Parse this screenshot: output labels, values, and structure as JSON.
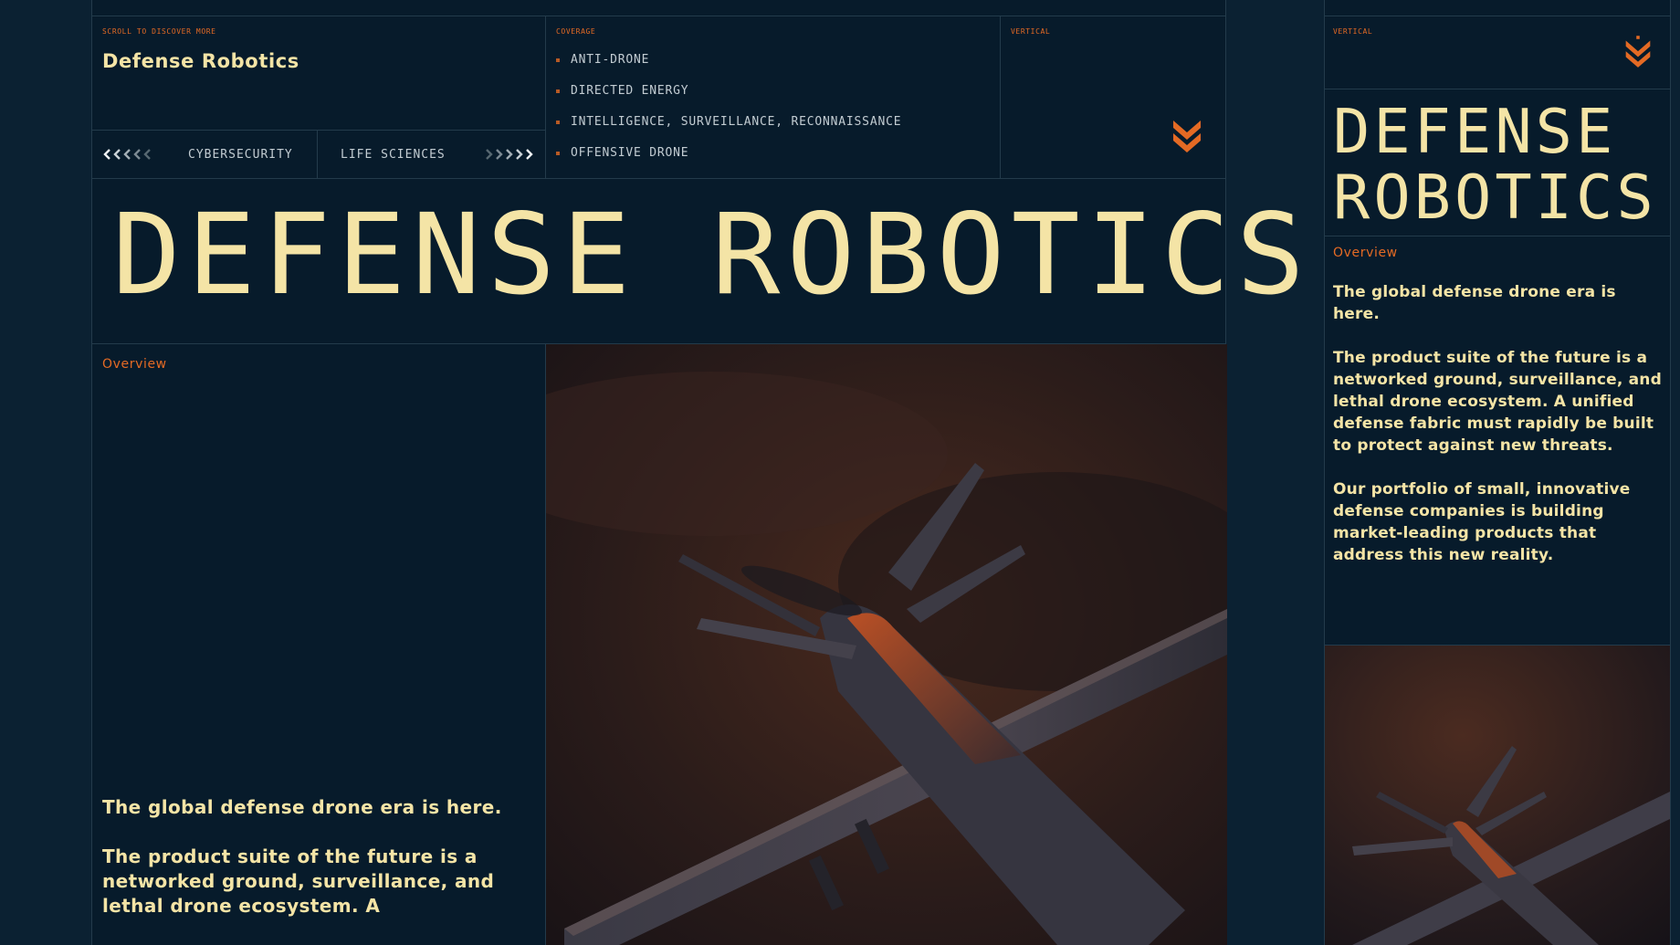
{
  "header": {
    "scroll_hint": "SCROLL TO DISCOVER MORE",
    "title": "Defense Robotics"
  },
  "nav": {
    "prev_label": "CYBERSECURITY",
    "next_label": "LIFE SCIENCES"
  },
  "coverage": {
    "label": "COVERAGE",
    "items": [
      "ANTI-DRONE",
      "DIRECTED ENERGY",
      "INTELLIGENCE, SURVEILLANCE, RECONNAISSANCE",
      "OFFENSIVE DRONE"
    ]
  },
  "vertical": {
    "label": "VERTICAL",
    "icon": "chevron-down-icon"
  },
  "hero": {
    "title": "DEFENSE ROBOTICS"
  },
  "overview": {
    "label": "Overview",
    "paragraphs": [
      "The global defense drone era is here.",
      "The product suite of the future is a networked ground, surveillance, and lethal drone ecosystem. A"
    ]
  },
  "side_panel": {
    "vertical_label": "VERTICAL",
    "title_line1": "DEFENSE",
    "title_line2": "ROBOTICS",
    "overview_label": "Overview",
    "paragraphs": [
      "The global defense drone era is here.",
      "The product suite of the future is a networked ground, surveillance, and lethal drone ecosystem. A unified defense fabric must rapidly be built to protect against new threats.",
      "Our portfolio of small, innovative defense companies is building market-leading products that address this new reality."
    ]
  },
  "colors": {
    "background": "#0b2132",
    "panel": "#071b2b",
    "accent": "#e46a24",
    "cream": "#f4e4a6"
  }
}
